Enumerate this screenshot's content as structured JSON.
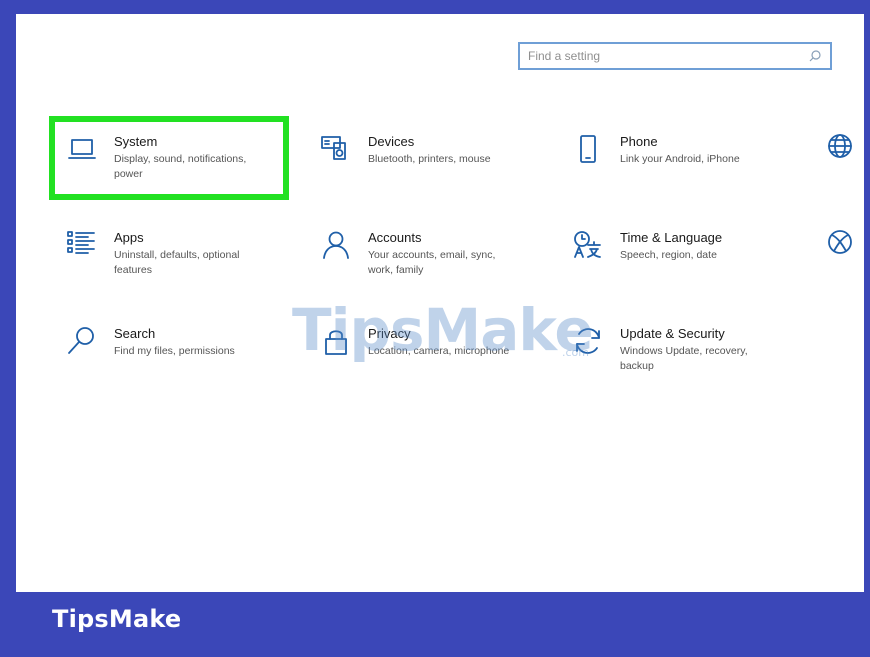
{
  "search": {
    "placeholder": "Find a setting"
  },
  "tiles": [
    {
      "title": "System",
      "desc": "Display, sound, notifications, power",
      "icon": "laptop-icon"
    },
    {
      "title": "Devices",
      "desc": "Bluetooth, printers, mouse",
      "icon": "devices-icon"
    },
    {
      "title": "Phone",
      "desc": "Link your Android, iPhone",
      "icon": "phone-icon"
    },
    {
      "title": "Apps",
      "desc": "Uninstall, defaults, optional features",
      "icon": "apps-list-icon"
    },
    {
      "title": "Accounts",
      "desc": "Your accounts, email, sync, work, family",
      "icon": "person-icon"
    },
    {
      "title": "Time & Language",
      "desc": "Speech, region, date",
      "icon": "time-language-icon"
    },
    {
      "title": "Search",
      "desc": "Find my files, permissions",
      "icon": "magnifier-icon"
    },
    {
      "title": "Privacy",
      "desc": "Location, camera, microphone",
      "icon": "lock-icon"
    },
    {
      "title": "Update & Security",
      "desc": "Windows Update, recovery, backup",
      "icon": "sync-arrows-icon"
    }
  ],
  "partial_icons": [
    "globe-icon",
    "xbox-icon"
  ],
  "highlight_color": "#22e122",
  "accent_color": "#1f5fa8",
  "frame_color": "#3b47b8",
  "watermark": {
    "main": "TipsMake",
    "suffix": ".com"
  },
  "footer": {
    "brand": "TipsMake"
  }
}
